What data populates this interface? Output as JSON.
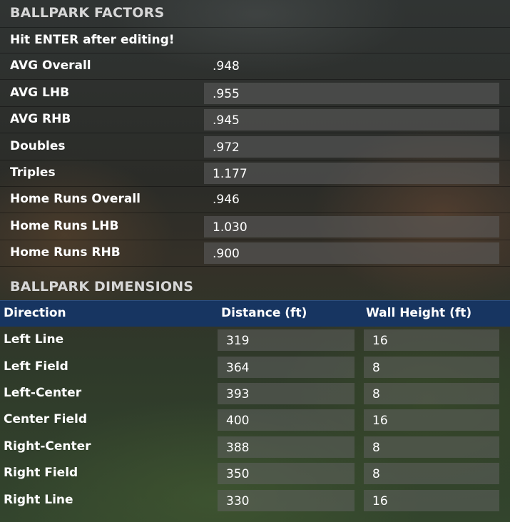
{
  "factors": {
    "title": "BALLPARK FACTORS",
    "note": "Hit ENTER after editing!",
    "rows": [
      {
        "label": "AVG Overall",
        "value": ".948",
        "editable": false
      },
      {
        "label": "AVG LHB",
        "value": ".955",
        "editable": true
      },
      {
        "label": "AVG RHB",
        "value": ".945",
        "editable": true
      },
      {
        "label": "Doubles",
        "value": ".972",
        "editable": true
      },
      {
        "label": "Triples",
        "value": "1.177",
        "editable": true
      },
      {
        "label": "Home Runs Overall",
        "value": ".946",
        "editable": false
      },
      {
        "label": "Home Runs LHB",
        "value": "1.030",
        "editable": true
      },
      {
        "label": "Home Runs RHB",
        "value": ".900",
        "editable": true
      }
    ]
  },
  "dimensions": {
    "title": "BALLPARK DIMENSIONS",
    "header_color": "#173561",
    "columns": {
      "direction": "Direction",
      "distance": "Distance (ft)",
      "wall_height": "Wall Height (ft)"
    },
    "rows": [
      {
        "direction": "Left Line",
        "distance": "319",
        "wall_height": "16"
      },
      {
        "direction": "Left Field",
        "distance": "364",
        "wall_height": "8"
      },
      {
        "direction": "Left-Center",
        "distance": "393",
        "wall_height": "8"
      },
      {
        "direction": "Center Field",
        "distance": "400",
        "wall_height": "16"
      },
      {
        "direction": "Right-Center",
        "distance": "388",
        "wall_height": "8"
      },
      {
        "direction": "Right Field",
        "distance": "350",
        "wall_height": "8"
      },
      {
        "direction": "Right Line",
        "distance": "330",
        "wall_height": "16"
      }
    ]
  }
}
